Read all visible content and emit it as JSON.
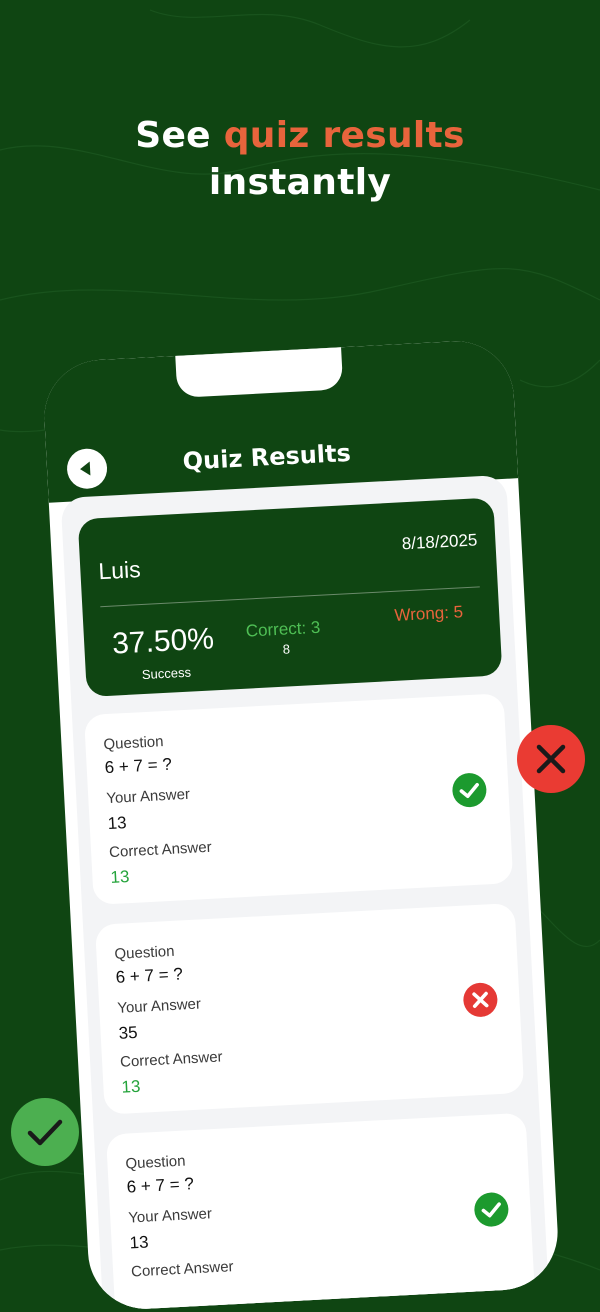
{
  "headline": {
    "prefix": "See ",
    "highlight": "quiz results",
    "suffix": "instantly"
  },
  "app": {
    "title": "Quiz Results"
  },
  "summary": {
    "name": "Luis",
    "date": "8/18/2025",
    "percent": "37.50%",
    "success_label": "Success",
    "correct": "Correct: 3",
    "total": "8",
    "wrong": "Wrong: 5"
  },
  "labels": {
    "question": "Question",
    "your_answer": "Your Answer",
    "correct_answer": "Correct Answer"
  },
  "results": [
    {
      "question": "6 + 7 = ?",
      "your_answer": "13",
      "correct_answer": "13",
      "status": "correct"
    },
    {
      "question": "6 + 7 = ?",
      "your_answer": "35",
      "correct_answer": "13",
      "status": "wrong"
    },
    {
      "question": "6 + 7 = ?",
      "your_answer": "13",
      "correct_answer": "",
      "status": "correct"
    }
  ],
  "colors": {
    "background": "#0f4512",
    "accent": "#e8643c",
    "correct": "#1c9a2e",
    "wrong": "#e53935"
  }
}
